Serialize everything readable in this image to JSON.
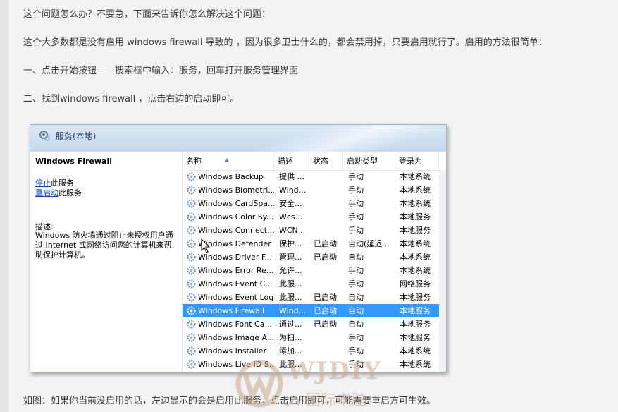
{
  "article": {
    "p1": "这个问题怎么办？不要急，下面来告诉你怎么解决这个问题：",
    "p2": "这个大多数都是没有启用 windows firewall 导致的 ，因为很多卫士什么的，都会禁用掉，只要启用就行了。启用的方法很简单：",
    "p3": "一、点击开始按钮——搜索框中输入：服务，回车打开服务管理界面",
    "p4": "二、找到windows firewall ，点击右边的启动即可。",
    "p5": "如图：如果你当前没启用的话，左边显示的会是启用此服务，点击启用即可，可能需要重启方可生效。"
  },
  "services_window": {
    "title": "服务(本地)",
    "left_pane": {
      "service_name": "Windows Firewall",
      "stop_link": "停止",
      "stop_suffix": "此服务",
      "restart_link": "重启动",
      "restart_suffix": "此服务",
      "desc_label": "描述:",
      "description": "Windows 防火墙通过阻止未授权用户通过 Internet 或网络访问您的计算机来帮助保护计算机。"
    },
    "columns": {
      "name": "名称",
      "desc": "描述",
      "state": "状态",
      "startup": "启动类型",
      "logon": "登录为"
    },
    "rows": [
      {
        "name": "Windows Backup",
        "desc": "提供 ...",
        "state": "",
        "startup": "手动",
        "logon": "本地系统"
      },
      {
        "name": "Windows Biometri...",
        "desc": "Wind...",
        "state": "",
        "startup": "手动",
        "logon": "本地系统"
      },
      {
        "name": "Windows CardSpa...",
        "desc": "安全...",
        "state": "",
        "startup": "手动",
        "logon": "本地系统"
      },
      {
        "name": "Windows Color Sy...",
        "desc": "Wcs...",
        "state": "",
        "startup": "手动",
        "logon": "本地服务"
      },
      {
        "name": "Windows Connect...",
        "desc": "WCN...",
        "state": "",
        "startup": "手动",
        "logon": "本地服务"
      },
      {
        "name": "Windows Defender",
        "desc": "保护...",
        "state": "已启动",
        "startup": "自动(延迟...",
        "logon": "本地系统"
      },
      {
        "name": "Windows Driver F...",
        "desc": "管理...",
        "state": "已启动",
        "startup": "自动",
        "logon": "本地系统"
      },
      {
        "name": "Windows Error Re...",
        "desc": "允许...",
        "state": "",
        "startup": "手动",
        "logon": "本地系统"
      },
      {
        "name": "Windows Event C...",
        "desc": "此服...",
        "state": "",
        "startup": "手动",
        "logon": "网络服务"
      },
      {
        "name": "Windows Event Log",
        "desc": "此服...",
        "state": "已启动",
        "startup": "自动",
        "logon": "本地服务"
      },
      {
        "name": "Windows Firewall",
        "desc": "Wind...",
        "state": "已启动",
        "startup": "自动",
        "logon": "本地服务"
      },
      {
        "name": "Windows Font Ca...",
        "desc": "通过...",
        "state": "已启动",
        "startup": "自动",
        "logon": "本地服务"
      },
      {
        "name": "Windows Image A...",
        "desc": "为扫...",
        "state": "",
        "startup": "手动",
        "logon": "本地服务"
      },
      {
        "name": "Windows Installer",
        "desc": "添加...",
        "state": "",
        "startup": "手动",
        "logon": "本地系统"
      },
      {
        "name": "Windows Live ID S...",
        "desc": "此服...",
        "state": "",
        "startup": "手动",
        "logon": "本地系统"
      }
    ],
    "selected_index": 10
  },
  "watermark": {
    "brand": "WJDIY",
    "sub": "cn 国际电脑"
  },
  "colors": {
    "selection": "#3399ff",
    "link": "#0645ad",
    "watermark": "#c7a98b"
  }
}
